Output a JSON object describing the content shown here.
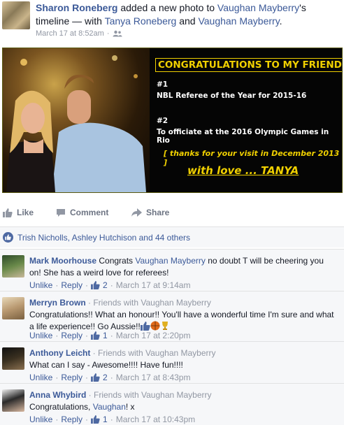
{
  "post": {
    "author": "Sharon Roneberg",
    "action_text": " added a new photo to ",
    "target": "Vaughan Mayberry",
    "possessive_suffix": "'s",
    "timeline_with": " timeline — with ",
    "tagged_1": "Tanya Roneberg",
    "and_text": " and ",
    "tagged_2": "Vaughan Mayberry",
    "period": ".",
    "timestamp": "March 17 at 8:52am"
  },
  "photo": {
    "title": "CONGRATULATIONS TO MY FRIEND",
    "item1_num": "#1",
    "item1_text": "NBL Referee of the Year for 2015-16",
    "item2_num": "#2",
    "item2_text": "To officiate at the 2016 Olympic Games in Rio",
    "thanks": "[ thanks for your visit in December 2013 ]",
    "signoff": "with love ... TANYA",
    "accent_color": "#f0d000"
  },
  "actions": {
    "like": "Like",
    "comment": "Comment",
    "share": "Share"
  },
  "likes": {
    "text": "Trish Nicholls, Ashley Hutchison and 44 others"
  },
  "comments": [
    {
      "author": "Mark Moorhouse",
      "friends": "",
      "text_before": " Congrats ",
      "mention": "Vaughan Mayberry",
      "text_after": " no doubt T will be cheering you on! She has a weird love for referees!",
      "unlike": "Unlike",
      "reply": "Reply",
      "likes": "2",
      "time": "March 17 at 9:14am"
    },
    {
      "author": "Merryn Brown",
      "friends": " · Friends with Vaughan Mayberry",
      "text": "Congratulations!! What an honour!! You'll have a wonderful time I'm sure and what a life experience!! Go Aussie!!",
      "unlike": "Unlike",
      "reply": "Reply",
      "likes": "1",
      "time": "March 17 at 2:20pm"
    },
    {
      "author": "Anthony Leicht",
      "friends": " · Friends with Vaughan Mayberry",
      "text": "What can I say - Awesome!!!! Have fun!!!!",
      "unlike": "Unlike",
      "reply": "Reply",
      "likes": "2",
      "time": "March 17 at 8:43pm"
    },
    {
      "author": "Anna Whybird",
      "friends": " · Friends with Vaughan Mayberry",
      "text_before": "Congratulations, ",
      "mention": "Vaughan",
      "text_after": "! x",
      "unlike": "Unlike",
      "reply": "Reply",
      "likes": "1",
      "time": "March 17 at 10:43pm"
    }
  ]
}
